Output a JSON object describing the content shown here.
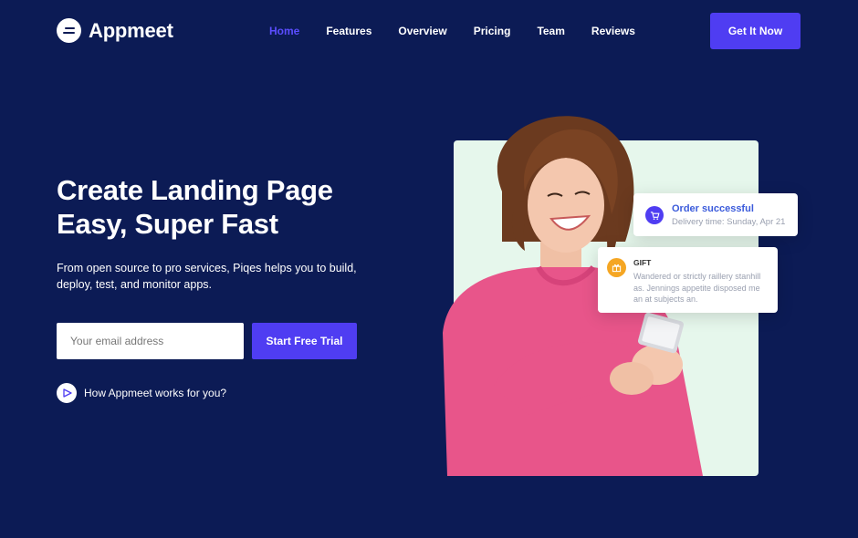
{
  "brand": {
    "name": "Appmeet"
  },
  "nav": {
    "items": [
      {
        "label": "Home",
        "active": true
      },
      {
        "label": "Features"
      },
      {
        "label": "Overview"
      },
      {
        "label": "Pricing"
      },
      {
        "label": "Team"
      },
      {
        "label": "Reviews"
      }
    ],
    "cta_label": "Get It Now"
  },
  "hero": {
    "title_line1": "Create Landing Page",
    "title_line2": "Easy, Super Fast",
    "subtitle": "From open source to pro services, Piqes helps you to build, deploy, test, and monitor apps.",
    "email_placeholder": "Your email address",
    "trial_label": "Start Free Trial",
    "video_link": "How Appmeet works for you?"
  },
  "notifications": {
    "order": {
      "title": "Order successful",
      "detail": "Delivery time: Sunday, Apr 21",
      "icon": "cart-icon"
    },
    "gift": {
      "title": "GIFT",
      "detail": "Wandered or strictly raillery stanhill as. Jennings appetite disposed me an at subjects an.",
      "icon": "gift-icon"
    }
  },
  "colors": {
    "background": "#0c1b55",
    "accent": "#4f3df2",
    "nav_active": "#5b4dff",
    "card_bg": "#e6f7ec",
    "gift": "#f5a623"
  }
}
